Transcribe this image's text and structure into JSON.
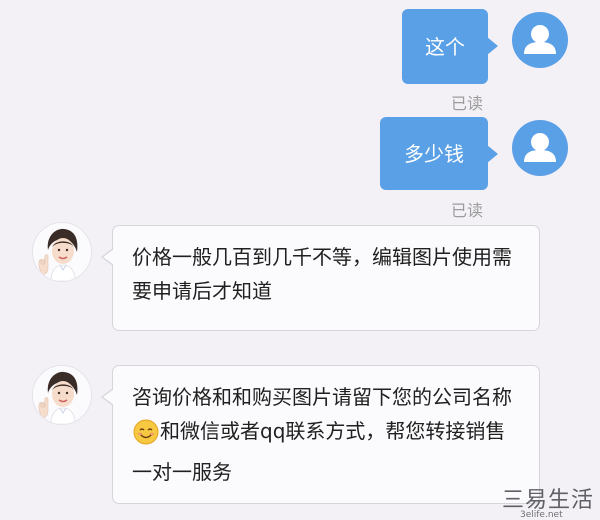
{
  "chat": {
    "outgoing": [
      {
        "text": "这个",
        "status": "已读"
      },
      {
        "text": "多少钱",
        "status": "已读"
      }
    ],
    "incoming": [
      {
        "text": "价格一般几百到几千不等，编辑图片使用需要申请后才知道"
      },
      {
        "text_before": "咨询价格和和购买图片请留下您的公司名称",
        "emoji": "smiling-face-icon",
        "text_after": "和微信或者qq联系方式，帮您转接销售一对一服务"
      }
    ]
  },
  "watermark": {
    "name": "三易生活",
    "url": "3elife.net"
  },
  "colors": {
    "background": "#f3f1f6",
    "outgoing_bubble": "#5aa0e6",
    "incoming_bubble": "#fbfbfd",
    "read_status": "#9c9c9c"
  }
}
